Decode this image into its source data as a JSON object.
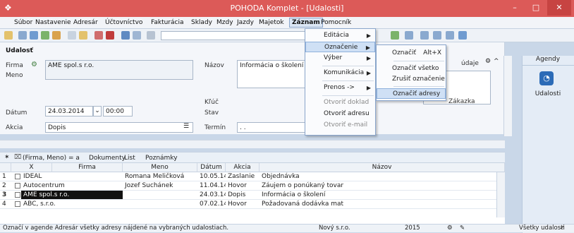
{
  "window": {
    "title": "POHODA Komplet - [Udalosti]",
    "minimize": "–",
    "maximize": "□",
    "close": "✕"
  },
  "menubar": {
    "items": [
      "Súbor",
      "Nastavenie",
      "Adresár",
      "Účtovníctvo",
      "Fakturácia",
      "Sklady",
      "Mzdy",
      "Jazdy",
      "Majetok",
      "Záznam",
      "Pomocník"
    ]
  },
  "form": {
    "section_title": "Udalosť",
    "firma_label": "Firma",
    "firma_value": "AME spol.s r.o.",
    "meno_label": "Meno",
    "datum_label": "Dátum",
    "datum_value": "24.03.2014",
    "time_value": "00:00",
    "akcia_label": "Akcia",
    "akcia_value": "Dopis",
    "nazov_label": "Názov",
    "nazov_value": "Informácia o školení",
    "kluc_label": "Kľúč",
    "stav_label": "Stav",
    "termin_label": "Termín",
    "termin_value": ". .",
    "udaje_label": "údaje",
    "zakazka_label": "Zákazka"
  },
  "agendy": {
    "title": "Agendy",
    "item": "Udalosti"
  },
  "tabs": {
    "filter": "(Firma, Meno) = a",
    "items": [
      "Dokumenty",
      "List",
      "Poznámky"
    ]
  },
  "grid": {
    "columns": [
      "X",
      "Firma",
      "Meno",
      "Dátum",
      "Akcia",
      "Názov"
    ],
    "rows": [
      {
        "n": "1",
        "firma": "IDEAL",
        "meno": "Romana Meličková",
        "datum": "10.05.14",
        "akcia": "Zaslanie",
        "nazov": "Objednávka"
      },
      {
        "n": "2",
        "firma": "Autocentrum",
        "meno": "Jozef Suchánek",
        "datum": "11.04.14",
        "akcia": "Hovor",
        "nazov": "Záujem o ponúkaný tovar"
      },
      {
        "n": "3",
        "firma": "AME spol.s r.o.",
        "meno": "",
        "datum": "24.03.14",
        "akcia": "Dopis",
        "nazov": "Informácia o školení"
      },
      {
        "n": "4",
        "firma": "ABC, s.r.o.",
        "meno": "",
        "datum": "07.02.14",
        "akcia": "Hovor",
        "nazov": "Požadovaná dodávka mat"
      }
    ]
  },
  "statusbar": {
    "message": "Označí v agende Adresár všetky adresy nájdené na vybraných udalostiach.",
    "company": "Nový s.r.o.",
    "year": "2015",
    "mode": "Všetky udalosti"
  },
  "menu_zaznam": {
    "items": [
      {
        "label": "Editácia",
        "submenu": true,
        "disabled": false
      },
      {
        "label": "Označenie",
        "submenu": true,
        "disabled": false
      },
      {
        "label": "Výber",
        "submenu": true,
        "disabled": false
      },
      {
        "label": "Komunikácia",
        "submenu": true,
        "disabled": false
      },
      {
        "label": "Prenos ->",
        "submenu": true,
        "disabled": false
      },
      {
        "label": "Otvoriť doklad",
        "submenu": false,
        "disabled": true
      },
      {
        "label": "Otvoriť adresu",
        "submenu": false,
        "disabled": false
      },
      {
        "label": "Otvoriť e-mail",
        "submenu": false,
        "disabled": true
      }
    ]
  },
  "menu_oznacenie": {
    "items": [
      {
        "label": "Označiť",
        "shortcut": "Alt+X"
      },
      {
        "label": "Označiť všetko",
        "shortcut": ""
      },
      {
        "label": "Zrušiť označenie",
        "shortcut": ""
      },
      {
        "label": "Označiť adresy",
        "shortcut": ""
      }
    ]
  }
}
